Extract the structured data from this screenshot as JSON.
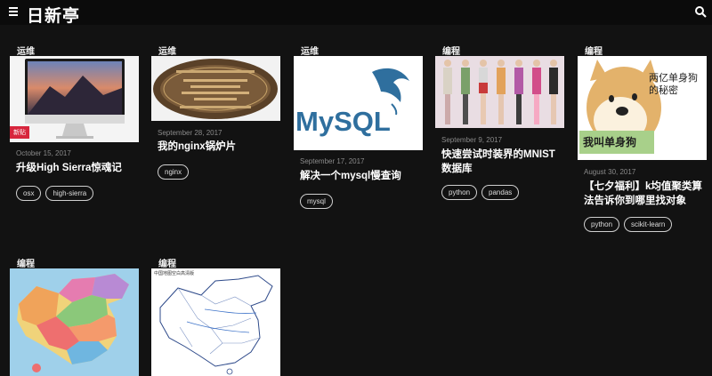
{
  "site": {
    "title": "日新亭"
  },
  "icons": {
    "menu": "menu-icon",
    "search": "search-icon"
  },
  "colors": {
    "background": "#121212",
    "topbar": "#0b0b0b",
    "badge": "#d7263d"
  },
  "posts": [
    {
      "category": "运维",
      "badge": "新贴",
      "date": "October 15, 2017",
      "title": "升级High Sierra惊魂记",
      "tags": [
        "osx",
        "high-sierra"
      ]
    },
    {
      "category": "运维",
      "date": "September 28, 2017",
      "title": "我的nginx锅炉片",
      "tags": [
        "nginx"
      ]
    },
    {
      "category": "运维",
      "date": "September 17, 2017",
      "title": "解决一个mysql慢查询",
      "tags": [
        "mysql"
      ],
      "logo": "MySQL"
    },
    {
      "category": "编程",
      "date": "September 9, 2017",
      "title": "快速尝试时装界的MNIST数据库",
      "tags": [
        "python",
        "pandas"
      ]
    },
    {
      "category": "编程",
      "date": "August 30, 2017",
      "title": "【七夕福利】k均值聚类算法告诉你到哪里找对象",
      "tags": [
        "python",
        "scikit-learn"
      ],
      "image_text": {
        "top": "两亿单身狗的秘密",
        "bottom": "我叫单身狗"
      }
    },
    {
      "category": "编程"
    },
    {
      "category": "编程",
      "image_caption": "中国地图空白高清版"
    }
  ]
}
